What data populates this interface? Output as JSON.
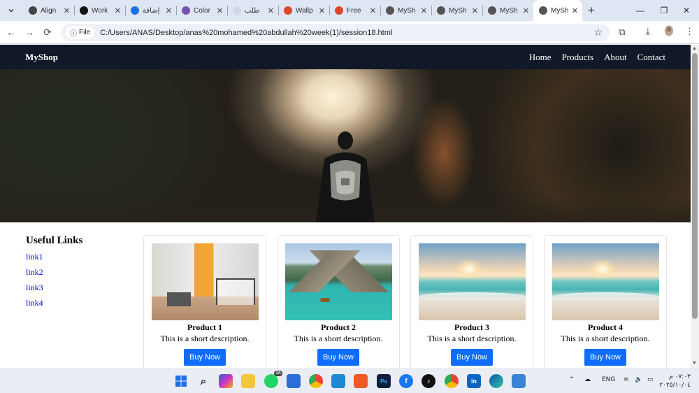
{
  "browser": {
    "tabs": [
      {
        "title": "Align",
        "favicon": "chatgpt-icon",
        "color": "#444444"
      },
      {
        "title": "Work",
        "favicon": "notion-icon",
        "color": "#111111"
      },
      {
        "title": "إضافة",
        "favicon": "swirl-icon",
        "color": "#1a73e8"
      },
      {
        "title": "Color",
        "favicon": "bootstrap-icon",
        "color": "#7952b3"
      },
      {
        "title": "طلب",
        "favicon": "blank-icon",
        "color": "#d0d7e6"
      },
      {
        "title": "Wallp",
        "favicon": "flame-icon",
        "color": "#e0452c"
      },
      {
        "title": "Free",
        "favicon": "flame-icon",
        "color": "#e0452c"
      },
      {
        "title": "MySh",
        "favicon": "globe-icon",
        "color": "#555555"
      },
      {
        "title": "MySh",
        "favicon": "globe-icon",
        "color": "#555555"
      },
      {
        "title": "MySh",
        "favicon": "globe-icon",
        "color": "#555555"
      },
      {
        "title": "MySh",
        "favicon": "globe-icon",
        "color": "#555555",
        "active": true
      }
    ],
    "address": {
      "scheme_label": "File",
      "url": "C:/Users/ANAS/Desktop/anas%20mohamed%20abdullah%20week(1)/session18.html"
    }
  },
  "site": {
    "brand": "MyShop",
    "nav": [
      "Home",
      "Products",
      "About",
      "Contact"
    ],
    "sidebar": {
      "heading": "Useful Links",
      "links": [
        "link1",
        "link2",
        "link3",
        "link4"
      ]
    },
    "products": [
      {
        "name": "Product 1",
        "description": "This is a short description.",
        "button": "Buy Now",
        "image": "room"
      },
      {
        "name": "Product 2",
        "description": "This is a short description.",
        "button": "Buy Now",
        "image": "lake"
      },
      {
        "name": "Product 3",
        "description": "This is a short description.",
        "button": "Buy Now",
        "image": "beach"
      },
      {
        "name": "Product 4",
        "description": "This is a short description.",
        "button": "Buy Now",
        "image": "beach"
      }
    ],
    "colors": {
      "navbar": "#111827",
      "button": "#0d6efd",
      "link": "#0000ee"
    }
  },
  "taskbar": {
    "language": "ENG",
    "time": "٠٧:٠٣ م",
    "date": "٢٠٢٥/١٠/٠٤",
    "whatsapp_badge": "1A"
  }
}
